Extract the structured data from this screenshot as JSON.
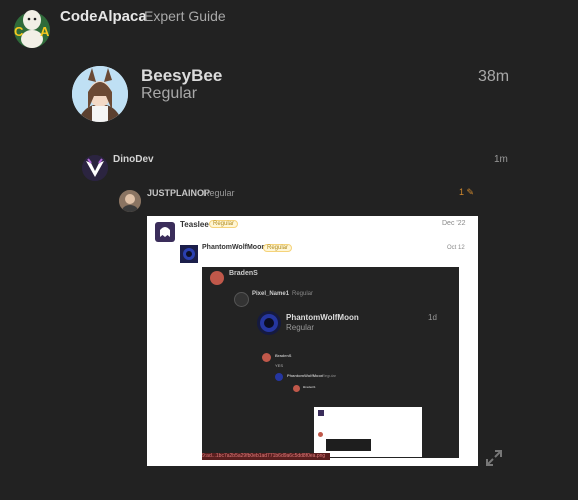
{
  "header": {
    "site_title": "CodeAlpaca",
    "site_subtitle": "Expert Guide",
    "logo_letters": "C A"
  },
  "post": {
    "username": "BeesyBee",
    "role": "Regular",
    "time": "38m"
  },
  "quote1": {
    "username": "DinoDev",
    "time": "1m"
  },
  "quote2": {
    "username": "JUSTPLAINOP",
    "role": "Regular",
    "edit_count": "1"
  },
  "screenshot": {
    "q3_user": "Teaslee",
    "q3_badge": "Regular",
    "q3_time": "Dec '22",
    "q4_user": "PhantomWolfMoon",
    "q4_badge": "Regular",
    "q4_time": "Oct 12",
    "q5_user": "BradenS",
    "q6_user": "Pixel_Name1",
    "q6_role": "Regular",
    "q7_user": "PhantomWolfMoon",
    "q7_role": "Regular",
    "q7_time": "1d",
    "q8_user": "BradenS",
    "q8_body": "YES",
    "q9_user": "PhantomWolfMoon",
    "q9_role": "Regular",
    "q10_user": "BradenS",
    "footer_hash": "9:ad...1bc7a2b5a29fb0eb1ad771b6d9a6c5dd8f0ea.png"
  },
  "colors": {
    "background": "#222222",
    "badge": "#f5d37a",
    "edit": "#d0892e"
  }
}
